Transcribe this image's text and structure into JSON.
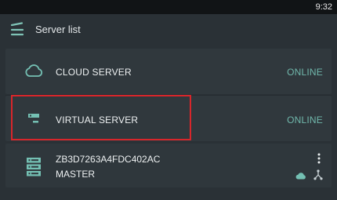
{
  "status_bar": {
    "time": "9:32"
  },
  "app_bar": {
    "title": "Server list",
    "menu_icon": "menu-icon"
  },
  "colors": {
    "background": "#2a3136",
    "card": "#30383d",
    "accent_online": "#70b7ab",
    "highlight": "#d8262b"
  },
  "servers": [
    {
      "label": "CLOUD SERVER",
      "status": "ONLINE",
      "icon": "cloud-icon"
    },
    {
      "label": "VIRTUAL SERVER",
      "status": "ONLINE",
      "icon": "virtual-server-icon"
    }
  ],
  "device": {
    "id": "ZB3D7263A4FDC402AC",
    "role": "MASTER",
    "icon": "server-rack-icon",
    "actions": [
      "more-vert-icon",
      "cloud-icon",
      "network-icon"
    ]
  }
}
